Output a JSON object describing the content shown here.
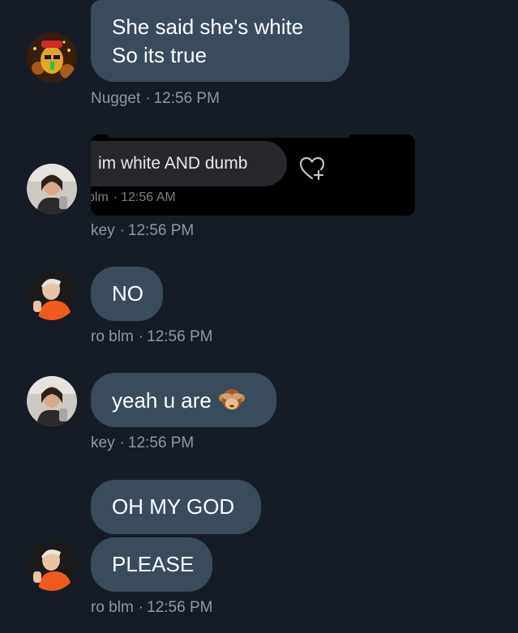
{
  "messages": [
    {
      "lines": [
        "She said she's white",
        "So its true"
      ],
      "author": "Nugget",
      "time": "12:56 PM"
    },
    {
      "quoted": {
        "text": "im white AND dumb",
        "author": "blm",
        "time": "12:56 AM"
      },
      "author": "key",
      "time": "12:56 PM"
    },
    {
      "lines": [
        "NO"
      ],
      "author": "ro blm",
      "time": "12:56 PM"
    },
    {
      "lines": [
        "yeah u are"
      ],
      "emoji": "see-no-evil-monkey-icon",
      "author": "key",
      "time": "12:56 PM"
    },
    {
      "lines": [
        "OH MY GOD"
      ]
    },
    {
      "lines": [
        "PLEASE"
      ],
      "author": "ro blm",
      "time": "12:56 PM"
    }
  ],
  "avatars": [
    {
      "user": "Nugget",
      "icon": "nugget-avatar"
    },
    {
      "user": "key",
      "icon": "key-avatar"
    },
    {
      "user": "ro blm",
      "icon": "ro-blm-avatar"
    },
    {
      "user": "key",
      "icon": "key-avatar"
    },
    {
      "user": "ro blm",
      "icon": "ro-blm-avatar"
    }
  ],
  "colors": {
    "background": "#151c26",
    "bubble": "#3a4c5c",
    "meta_text": "#8c99a6",
    "quote_background": "#000000"
  },
  "separator": "·"
}
